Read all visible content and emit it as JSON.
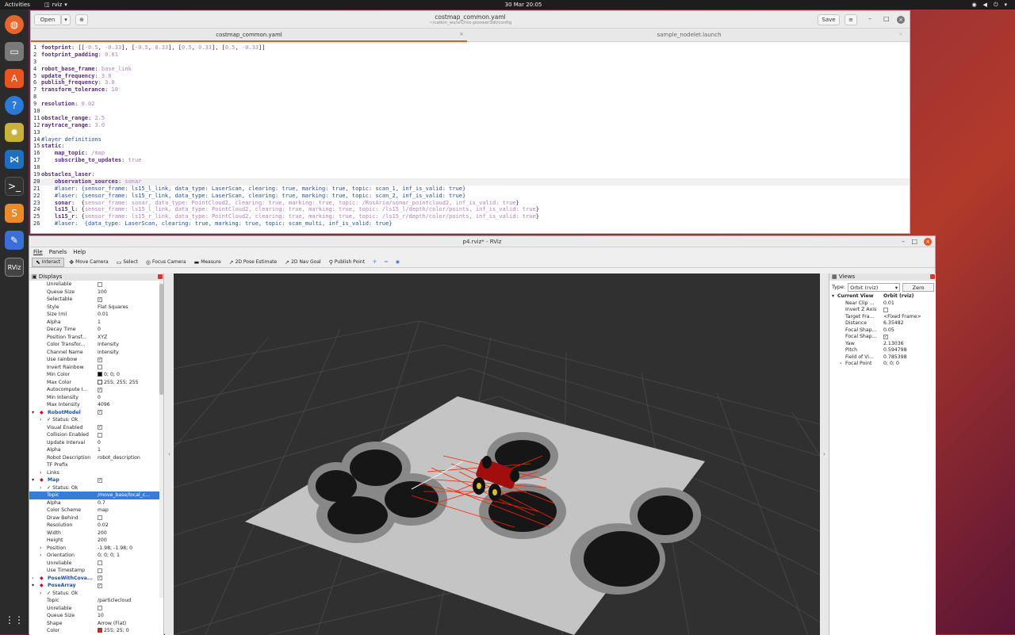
{
  "topbar": {
    "activities": "Activities",
    "app": "rviz",
    "clock": "30 Mar  20:05"
  },
  "dock": {
    "items": [
      "firefox-icon",
      "files-icon",
      "software-icon",
      "help-icon",
      "settings-icon",
      "vscode-icon",
      "terminal-icon",
      "sublime-icon",
      "text-editor-icon",
      "rviz-icon",
      "apps-grid-icon"
    ]
  },
  "gedit": {
    "open_label": "Open",
    "save_label": "Save",
    "title": "costmap_common.yaml",
    "path": "~/catkin_ws/src/ros-pioneer3dt/config",
    "tabs": [
      "costmap_common.yaml",
      "sample_nodelet.launch"
    ],
    "lines": [
      [
        [
          "k",
          "footprint"
        ],
        [
          "p",
          ": [["
        ],
        [
          "v",
          "-0.5"
        ],
        [
          "p",
          ", "
        ],
        [
          "v",
          "-0.33"
        ],
        [
          "p",
          "], ["
        ],
        [
          "v",
          "-0.5"
        ],
        [
          "p",
          ", "
        ],
        [
          "v",
          "0.33"
        ],
        [
          "p",
          "], ["
        ],
        [
          "v",
          "0.5"
        ],
        [
          "p",
          ", "
        ],
        [
          "v",
          "0.33"
        ],
        [
          "p",
          "], ["
        ],
        [
          "v",
          "0.5"
        ],
        [
          "p",
          ", "
        ],
        [
          "v",
          "-0.33"
        ],
        [
          "p",
          "]]"
        ]
      ],
      [
        [
          "k",
          "footprint_padding"
        ],
        [
          "p",
          ": "
        ],
        [
          "v",
          "0.01"
        ]
      ],
      [],
      [
        [
          "k",
          "robot_base_frame"
        ],
        [
          "p",
          ": "
        ],
        [
          "v",
          "base_link"
        ]
      ],
      [
        [
          "k",
          "update_frequency"
        ],
        [
          "p",
          ": "
        ],
        [
          "v",
          "3.0"
        ]
      ],
      [
        [
          "k",
          "publish_frequency"
        ],
        [
          "p",
          ": "
        ],
        [
          "v",
          "3.0"
        ]
      ],
      [
        [
          "k",
          "transform_tolerance"
        ],
        [
          "p",
          ": "
        ],
        [
          "v",
          "10"
        ]
      ],
      [],
      [
        [
          "k",
          "resolution"
        ],
        [
          "p",
          ": "
        ],
        [
          "v",
          "0.02"
        ]
      ],
      [],
      [
        [
          "k",
          "obstacle_range"
        ],
        [
          "p",
          ": "
        ],
        [
          "v",
          "2.5"
        ]
      ],
      [
        [
          "k",
          "raytrace_range"
        ],
        [
          "p",
          ": "
        ],
        [
          "v",
          "3.0"
        ]
      ],
      [],
      [
        [
          "c",
          "#layer definitions"
        ]
      ],
      [
        [
          "k",
          "static"
        ],
        [
          "p",
          ":"
        ]
      ],
      [
        [
          "p",
          "    "
        ],
        [
          "k",
          "map_topic"
        ],
        [
          "p",
          ": "
        ],
        [
          "v",
          "/map"
        ]
      ],
      [
        [
          "p",
          "    "
        ],
        [
          "k",
          "subscribe_to_updates"
        ],
        [
          "p",
          ": "
        ],
        [
          "v",
          "true"
        ]
      ],
      [],
      [
        [
          "k",
          "obstacles_laser"
        ],
        [
          "p",
          ":"
        ]
      ],
      [
        [
          "p",
          "    "
        ],
        [
          "k",
          "observation_sources"
        ],
        [
          "p",
          ": "
        ],
        [
          "v",
          "sonar"
        ]
      ],
      [
        [
          "p",
          "    "
        ],
        [
          "c",
          "#laser: {sensor_frame: ls15_l_link, data_type: LaserScan, clearing: true, marking: true, topic: scan_1, inf_is_valid: true}"
        ]
      ],
      [
        [
          "p",
          "    "
        ],
        [
          "c",
          "#laser: {sensor_frame: ls15_r_link, data_type: LaserScan, clearing: true, marking: true, topic: scan_2, inf_is_valid: true}"
        ]
      ],
      [
        [
          "p",
          "    "
        ],
        [
          "k",
          "sonar"
        ],
        [
          "p",
          ":  {"
        ],
        [
          "b",
          "sensor_frame: sonar, data_type: PointCloud2, clearing: true, marking: true, topic: /RosAria/sonar_pointcloud2, inf_is_valid: true"
        ],
        [
          "p",
          "}"
        ]
      ],
      [
        [
          "p",
          "    "
        ],
        [
          "k",
          "ls15_l"
        ],
        [
          "p",
          ": {"
        ],
        [
          "b",
          "sensor_frame: ls15_l_link, data_type: PointCloud2, clearing: true, marking: true, topic: /ls15_l/depth/color/points, inf_is_valid: true"
        ],
        [
          "p",
          "}"
        ]
      ],
      [
        [
          "p",
          "    "
        ],
        [
          "k",
          "ls15_r"
        ],
        [
          "p",
          ": {"
        ],
        [
          "b",
          "sensor_frame: ls15_r_link, data_type: PointCloud2, clearing: true, marking: true, topic: /ls15_r/depth/color/points, inf_is_valid: true"
        ],
        [
          "p",
          "}"
        ]
      ],
      [
        [
          "p",
          "    "
        ],
        [
          "c",
          "#laser:  {data_type: LaserScan, clearing: true, marking: true, topic: scan_multi, inf_is_valid: true}"
        ]
      ]
    ]
  },
  "rviz": {
    "title": "p4.rviz* - RViz",
    "menu": [
      "File",
      "Panels",
      "Help"
    ],
    "tools": [
      [
        "interact",
        "Interact"
      ],
      [
        "move-camera",
        "Move Camera"
      ],
      [
        "select",
        "Select"
      ],
      [
        "focus-camera",
        "Focus Camera"
      ],
      [
        "measure",
        "Measure"
      ],
      [
        "2d-pose-estimate",
        "2D Pose Estimate"
      ],
      [
        "2d-nav-goal",
        "2D Nav Goal"
      ],
      [
        "publish-point",
        "Publish Point"
      ]
    ],
    "displays_title": "Displays",
    "rows": [
      {
        "n": "Unreliable",
        "cb": false,
        "i": 1
      },
      {
        "n": "Queue Size",
        "v": "100",
        "i": 1
      },
      {
        "n": "Selectable",
        "cb": true,
        "i": 1
      },
      {
        "n": "Style",
        "v": "Flat Squares",
        "i": 1
      },
      {
        "n": "Size (m)",
        "v": "0.01",
        "i": 1
      },
      {
        "n": "Alpha",
        "v": "1",
        "i": 1
      },
      {
        "n": "Decay Time",
        "v": "0",
        "i": 1
      },
      {
        "n": "Position Transf...",
        "v": "XYZ",
        "i": 1
      },
      {
        "n": "Color Transfor...",
        "v": "Intensity",
        "i": 1
      },
      {
        "n": "Channel Name",
        "v": "intensity",
        "i": 1
      },
      {
        "n": "Use rainbow",
        "cb": true,
        "i": 1
      },
      {
        "n": "Invert Rainbow",
        "cb": false,
        "i": 1
      },
      {
        "n": "Min Color",
        "v": "0; 0; 0",
        "sw": "#000000",
        "i": 1
      },
      {
        "n": "Max Color",
        "v": "255; 255; 255",
        "sw": "#ffffff",
        "i": 1
      },
      {
        "n": "Autocompute I...",
        "cb": true,
        "i": 1
      },
      {
        "n": "Min Intensity",
        "v": "0",
        "i": 1
      },
      {
        "n": "Max Intensity",
        "v": "4096",
        "i": 1
      },
      {
        "n": "RobotModel",
        "cb": true,
        "i": 0,
        "d": true,
        "exp": "▾"
      },
      {
        "n": "✓ Status: Ok",
        "i": 1,
        "exp": "›"
      },
      {
        "n": "Visual Enabled",
        "cb": true,
        "i": 1
      },
      {
        "n": "Collision Enabled",
        "cb": false,
        "i": 1
      },
      {
        "n": "Update Interval",
        "v": "0",
        "i": 1
      },
      {
        "n": "Alpha",
        "v": "1",
        "i": 1
      },
      {
        "n": "Robot Description",
        "v": "robot_description",
        "i": 1
      },
      {
        "n": "TF Prefix",
        "v": "",
        "i": 1
      },
      {
        "n": "Links",
        "i": 1,
        "exp": "›"
      },
      {
        "n": "Map",
        "cb": true,
        "i": 0,
        "d": true,
        "exp": "▾"
      },
      {
        "n": "✓ Status: Ok",
        "i": 1,
        "exp": "›"
      },
      {
        "n": "Topic",
        "v": "/move_base/local_c...",
        "i": 1,
        "sel": true
      },
      {
        "n": "Alpha",
        "v": "0.7",
        "i": 1
      },
      {
        "n": "Color Scheme",
        "v": "map",
        "i": 1
      },
      {
        "n": "Draw Behind",
        "cb": false,
        "i": 1
      },
      {
        "n": "Resolution",
        "v": "0.02",
        "i": 1
      },
      {
        "n": "Width",
        "v": "200",
        "i": 1
      },
      {
        "n": "Height",
        "v": "200",
        "i": 1
      },
      {
        "n": "Position",
        "v": "-1.98; -1.98; 0",
        "i": 1,
        "exp": "›"
      },
      {
        "n": "Orientation",
        "v": "0; 0; 0; 1",
        "i": 1,
        "exp": "›"
      },
      {
        "n": "Unreliable",
        "cb": false,
        "i": 1
      },
      {
        "n": "Use Timestamp",
        "cb": false,
        "i": 1
      },
      {
        "n": "PoseWithCova...",
        "cb": true,
        "i": 0,
        "d": true,
        "exp": "›"
      },
      {
        "n": "PoseArray",
        "cb": true,
        "i": 0,
        "d": true,
        "exp": "▾"
      },
      {
        "n": "✓ Status: Ok",
        "i": 1,
        "exp": "›"
      },
      {
        "n": "Topic",
        "v": "/particlecloud",
        "i": 1
      },
      {
        "n": "Unreliable",
        "cb": false,
        "i": 1
      },
      {
        "n": "Queue Size",
        "v": "10",
        "i": 1
      },
      {
        "n": "Shape",
        "v": "Arrow (Flat)",
        "i": 1
      },
      {
        "n": "Color",
        "v": "255; 25; 0",
        "sw": "#ff1900",
        "i": 1
      }
    ],
    "views_title": "Views",
    "type_label": "Type:",
    "type_value": "Orbit (rviz)",
    "zero_label": "Zero",
    "view_rows": [
      {
        "n": "Current View",
        "v": "Orbit (rviz)",
        "bold": true,
        "exp": "▾"
      },
      {
        "n": "Near Clip ...",
        "v": "0.01"
      },
      {
        "n": "Invert Z Axis",
        "cb": false
      },
      {
        "n": "Target Fra...",
        "v": "<Fixed Frame>"
      },
      {
        "n": "Distance",
        "v": "6.35482"
      },
      {
        "n": "Focal Shap...",
        "v": "0.05"
      },
      {
        "n": "Focal Shap...",
        "cb": true
      },
      {
        "n": "Yaw",
        "v": "2.13036"
      },
      {
        "n": "Pitch",
        "v": "0.594798"
      },
      {
        "n": "Field of Vi...",
        "v": "0.785398"
      },
      {
        "n": "Focal Point",
        "v": "0; 0; 0",
        "exp": "›"
      }
    ]
  }
}
